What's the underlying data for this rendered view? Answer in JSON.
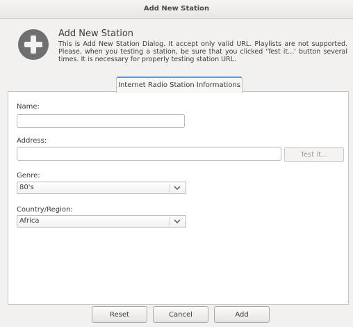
{
  "window": {
    "title": "Add New Station"
  },
  "header": {
    "icon": "add-circle-icon",
    "title": "Add New Station",
    "description": "This is Add New Station Dialog. It accept only valid URL. Playlists are not supported. Please, when you testing a station, be sure that you clicked 'Test it...' button several times. It is necessary for properly testing station URL."
  },
  "tabs": [
    {
      "label": "Internet Radio Station Informations",
      "active": true
    }
  ],
  "form": {
    "name": {
      "label": "Name:",
      "value": "",
      "placeholder": ""
    },
    "address": {
      "label": "Address:",
      "value": "",
      "placeholder": "",
      "test_button": "Test it..."
    },
    "genre": {
      "label": "Genre:",
      "selected": "80's"
    },
    "country": {
      "label": "Country/Region:",
      "selected": "Africa"
    }
  },
  "buttons": {
    "reset": "Reset",
    "cancel": "Cancel",
    "add": "Add"
  },
  "colors": {
    "accent": "#5e9bd4",
    "window_bg": "#f2f1f0",
    "icon": "#6f6f6f"
  }
}
